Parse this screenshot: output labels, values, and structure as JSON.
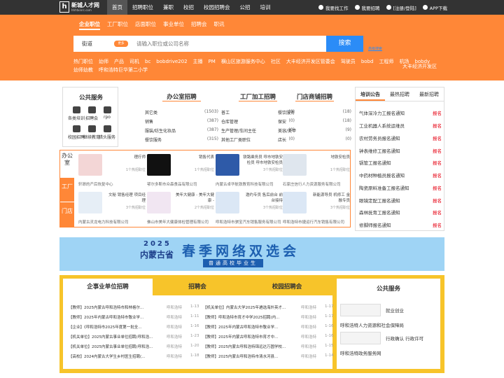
{
  "logo": {
    "name": "新城人才网",
    "domain": "hhhtxinrc.com",
    "mark": "h"
  },
  "nav": [
    "首页",
    "招聘职位",
    "兼职",
    "校招",
    "校园招聘会",
    "公招",
    "培训"
  ],
  "top_right": [
    "我要找工作",
    "我要招聘",
    "[注册/登陆]",
    "APP下载"
  ],
  "search": {
    "tabs": [
      "企业职位",
      "工厂职位",
      "店面职位",
      "事业单位",
      "招聘会",
      "职讯"
    ],
    "location": "街道",
    "location_tag": "更多",
    "placeholder": "请输入职位或公司名称",
    "button": "搜索",
    "advanced": "高级搜索"
  },
  "hot": [
    "热门职位",
    "幼师",
    "产品",
    "司机",
    "bc",
    "bobdrive202",
    "主播",
    "PM",
    "横山区旅游服务中心",
    "社区",
    "大丰经济开发区管委会",
    "驾驶员",
    "bobd",
    "工程师",
    "机场",
    "bobdy",
    "幼师幼教",
    "呼和浩特巨华第二小学"
  ],
  "hot_right": "大丰经济开发区",
  "public_service": {
    "title": "公共服务",
    "items": [
      "各类培训",
      "招聘会",
      "rpo",
      "校园招聘",
      "继续教育",
      "猎头服务"
    ]
  },
  "cols": [
    {
      "title": "办公室招聘",
      "rows": [
        [
          "其它类",
          "(1503)"
        ],
        [
          "销售",
          "(387)"
        ],
        [
          "服装/纺生化妆品",
          "(387)"
        ],
        [
          "餐饮服务",
          "(315)"
        ]
      ]
    },
    {
      "title": "工厂加工招聘",
      "rows": [
        [
          "普工",
          "(0)"
        ],
        [
          "仓库管理",
          "(0)"
        ],
        [
          "生产管理/车间主任",
          "(0)"
        ],
        [
          "其他工厂类职位",
          "(0)"
        ]
      ]
    },
    {
      "title": "门店商铺招聘",
      "rows": [
        [
          "餐饮服务",
          "(18)"
        ],
        [
          "保安",
          "(18)"
        ],
        [
          "美容/美甲",
          "(9)"
        ],
        [
          "店长",
          "(0)"
        ]
      ]
    }
  ],
  "right_tabs": {
    "tabs": [
      "培训公告",
      "最热招聘",
      "最新招聘"
    ],
    "rows": [
      "气体深冷力工报名通知",
      "工业机器人系统运维员",
      "农村劳务员报名通知",
      "钟表维修工报名通知",
      "锅管工报名通知",
      "中药材种植员报名通知",
      "陶瓷原料准备工报名通知",
      "眼镜定配工报名通知",
      "森林抚育工报名通知",
      "修脚师报名通知"
    ],
    "badge": "报名"
  },
  "grid": {
    "side": [
      "办公室",
      "工厂",
      "门店"
    ],
    "cards": [
      {
        "name": "理疗师",
        "count": "1个热招职位",
        "comp": "轩昂的产后恢复中心"
      },
      {
        "name": "销售代表",
        "count": "1个热招职位",
        "comp": "鄂尔多斯市众森食品有限公司"
      },
      {
        "name": "铁路乘务员 呼市地铁安检员 呼市地铁安检员",
        "count": "3个热招职位",
        "comp": "内蒙古卓华航铁教育科技有限公司"
      },
      {
        "name": "地铁安检员",
        "count": "1个热招职位",
        "comp": "石家庄信行人力资源服务有限公司"
      },
      {
        "name": "文秘 销售经理 项目经理",
        "count": "3个热招职位",
        "comp": "内蒙古灵龙电力科技有限公司"
      },
      {
        "name": "美年大健康 - 美年大健康 -",
        "count": "2个热招职位",
        "comp": "佛山市美年大健康体检管理有限公司"
      },
      {
        "name": "邀约专员 售后前台 前台接待",
        "count": "3个热招职位",
        "comp": "呼和浩特市骐宝汽车销售服务有限公司"
      },
      {
        "name": "新能源导员 机修工 金融专员",
        "count": "3个热招职位",
        "comp": "呼和浩特市捷运行汽车销售有限公司"
      }
    ]
  },
  "banner": {
    "year": "2025",
    "left": "内蒙古省",
    "title": "春季网络双选会",
    "sub": "普通高校毕业生"
  },
  "bottom": {
    "tabs": [
      "企事业单位招聘",
      "招聘会",
      "校园招聘会"
    ],
    "rows_left": [
      [
        "【教师】2025内蒙古呼和浩特市和林格尔...",
        "呼和浩特",
        "1-13"
      ],
      [
        "【教师】2025年内蒙古呼和浩特市敬业学...",
        "呼和浩特",
        "1-11"
      ],
      [
        "【企业】《呼和浩特市2025年度第一批全...",
        "呼和浩特",
        "1-16"
      ],
      [
        "【机关单位】2025内蒙古事业单位招聘(呼和浩...",
        "呼和浩特",
        "1-23"
      ],
      [
        "【机关单位】2025内蒙古事业单位招聘(呼和浩...",
        "呼和浩特",
        "1-20"
      ],
      [
        "【高校】2024内蒙古大学生乡村医生招聘(...",
        "呼和浩特",
        "1-18"
      ]
    ],
    "rows_right": [
      [
        "【机关单位】内蒙古大学2025年遴选海外英才...",
        "呼和浩特",
        "1-17"
      ],
      [
        "【教师】呼和浩特市育才中学2025招聘(内...",
        "呼和浩特",
        "1-17"
      ],
      [
        "【教师】2025年内蒙古呼和浩特市敬业学...",
        "呼和浩特",
        "1-16"
      ],
      [
        "【教师】2025年内蒙古呼和浩特市育才中...",
        "呼和浩特",
        "1-16"
      ],
      [
        "【教师】2025内蒙古呼和浩特锦远达万圆学校...",
        "呼和浩特",
        "1-15"
      ],
      [
        "【教师】2025内蒙古呼和浩特市清水河县...",
        "呼和浩特",
        "1-14"
      ]
    ],
    "pub_title": "公共服务",
    "pub_items": [
      {
        "side": "就业创业",
        "cap": "呼和浩特人力资源和社会保障局"
      },
      {
        "side": "行政确认 行政许可",
        "cap": "呼和浩特政务服务网"
      }
    ]
  }
}
